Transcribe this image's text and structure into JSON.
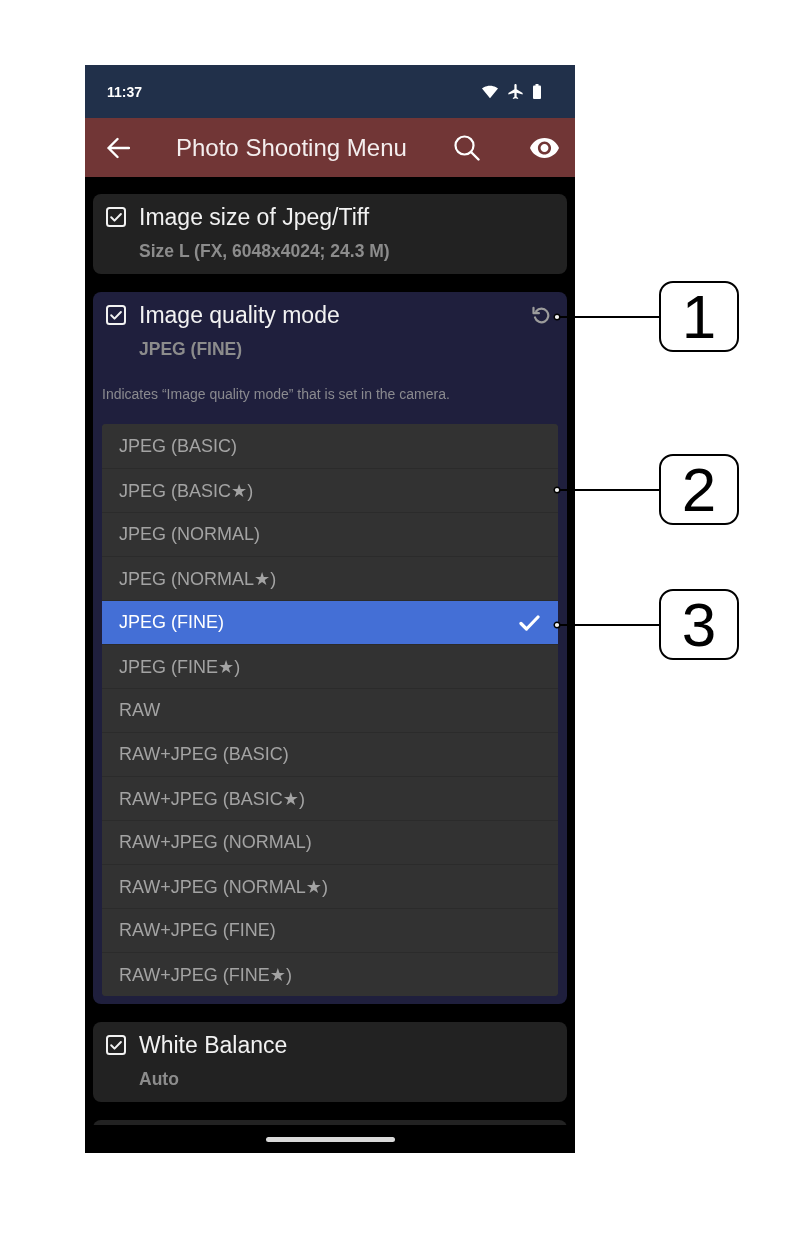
{
  "status_bar": {
    "time": "11:37"
  },
  "app_bar": {
    "title": "Photo Shooting Menu"
  },
  "settings": [
    {
      "title": "Image size of Jpeg/Tiff",
      "value": "Size L (FX, 6048x4024; 24.3 M)",
      "checked": true,
      "expanded": false
    },
    {
      "title": "Image quality mode",
      "value": "JPEG (FINE)",
      "checked": true,
      "expanded": true,
      "description": "Indicates “Image quality mode” that is set in the camera.",
      "options": [
        {
          "label": "JPEG (BASIC)",
          "selected": false
        },
        {
          "label": "JPEG (BASIC★)",
          "selected": false
        },
        {
          "label": "JPEG (NORMAL)",
          "selected": false
        },
        {
          "label": "JPEG (NORMAL★)",
          "selected": false
        },
        {
          "label": "JPEG (FINE)",
          "selected": true
        },
        {
          "label": "JPEG (FINE★)",
          "selected": false
        },
        {
          "label": "RAW",
          "selected": false
        },
        {
          "label": "RAW+JPEG (BASIC)",
          "selected": false
        },
        {
          "label": "RAW+JPEG (BASIC★)",
          "selected": false
        },
        {
          "label": "RAW+JPEG (NORMAL)",
          "selected": false
        },
        {
          "label": "RAW+JPEG (NORMAL★)",
          "selected": false
        },
        {
          "label": "RAW+JPEG (FINE)",
          "selected": false
        },
        {
          "label": "RAW+JPEG (FINE★)",
          "selected": false
        }
      ]
    },
    {
      "title": "White Balance",
      "value": "Auto",
      "checked": true,
      "expanded": false
    }
  ],
  "callouts": [
    {
      "label": "1"
    },
    {
      "label": "2"
    },
    {
      "label": "3"
    }
  ]
}
